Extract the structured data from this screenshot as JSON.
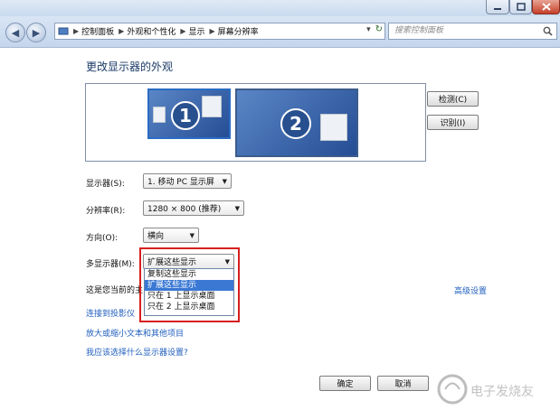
{
  "nav": {
    "breadcrumbs": [
      "控制面板",
      "外观和个性化",
      "显示",
      "屏幕分辨率"
    ],
    "search_placeholder": "搜索控制面板"
  },
  "page": {
    "title": "更改显示器的外观"
  },
  "preview": {
    "monitor1_number": "1",
    "monitor2_number": "2",
    "detect_label": "检测(C)",
    "identify_label": "识别(I)"
  },
  "settings": {
    "display_label": "显示器(S):",
    "display_value": "1. 移动 PC 显示屏",
    "resolution_label": "分辨率(R):",
    "resolution_value": "1280 × 800 (推荐)",
    "orientation_label": "方向(O):",
    "orientation_value": "横向",
    "multi_label": "多显示器(M):",
    "multi_value": "扩展这些显示",
    "multi_options": [
      "复制这些显示",
      "扩展这些显示",
      "只在 1 上显示桌面",
      "只在 2 上显示桌面"
    ],
    "multi_selected_index": 1,
    "current_text_partial": "这是您当前的主",
    "advanced_link": "高级设置"
  },
  "links": {
    "projector": "连接到投影仪",
    "text_size": "放大或缩小文本和其他项目",
    "help": "我应该选择什么显示器设置?"
  },
  "buttons": {
    "ok": "确定",
    "cancel": "取消"
  },
  "watermark": {
    "text": "电子发烧友"
  },
  "colors": {
    "highlight_box": "#d71e1e",
    "selected_option": "#3a78d4",
    "link": "#1f5ebd"
  }
}
